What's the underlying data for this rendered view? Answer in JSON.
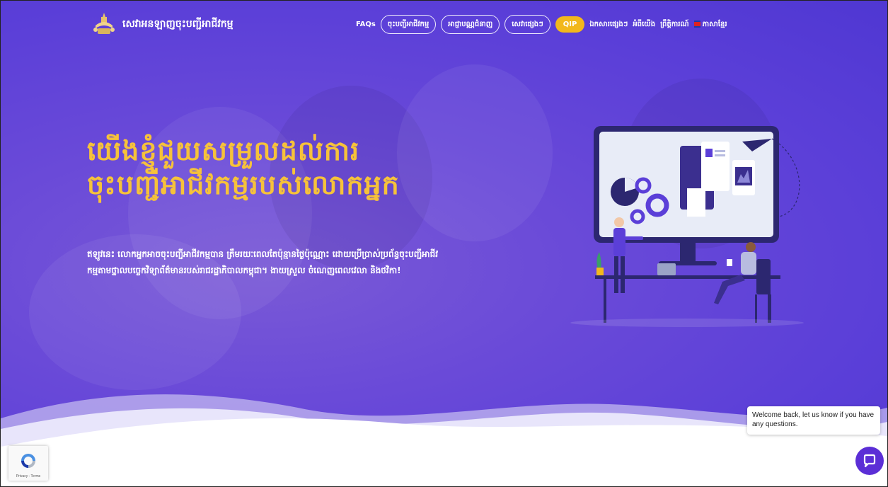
{
  "header": {
    "site_title": "សេវាអនឡាញចុះបញ្ជីអាជីវកម្ម"
  },
  "nav": {
    "faqs": "FAQs",
    "register_business": "ចុះបញ្ជីអាជីវកម្ម",
    "pay_online": "អាជ្ញាបណ្ណជំនាញ",
    "other_services": "សេវាផ្សេងៗ",
    "qip": "QIP",
    "other_documents": "ឯកសារផ្សេងៗ",
    "about": "អំពីយើង",
    "news": "ព្រឹត្តិការណ៍",
    "language": "ភាសាខ្មែរ"
  },
  "hero": {
    "headline_line1": "យើងខ្ញុំជួយសម្រួលដល់ការ",
    "headline_line2": "ចុះបញ្ជីអាជីវកម្មរបស់លោកអ្នក",
    "description": "ឥឡូវនេះ លោកអ្នកអាចចុះបញ្ជីអាជីវកម្មបាន ត្រឹមរយៈពេលតែប៉ុន្មានថ្ងៃប៉ុណ្ណោះ ដោយប្រើប្រាស់ប្រព័ន្ធចុះបញ្ជីអាជីវកម្មតាមថ្នាលបច្ចេកវិទ្យាព័ត៌មានរបស់រាជរដ្ឋាភិបាលកម្ពុជា។ ងាយស្រួល ចំណេញពេលវេលា និងថវិកា!"
  },
  "chat": {
    "welcome_message": "Welcome back, let us know if you have any questions."
  },
  "recaptcha": {
    "label": "Privacy - Terms"
  },
  "colors": {
    "hero_bg": "#5b3fd8",
    "headline": "#f6c23a",
    "qip_pill": "#f2b81c",
    "chat_button": "#5b2ed6"
  }
}
